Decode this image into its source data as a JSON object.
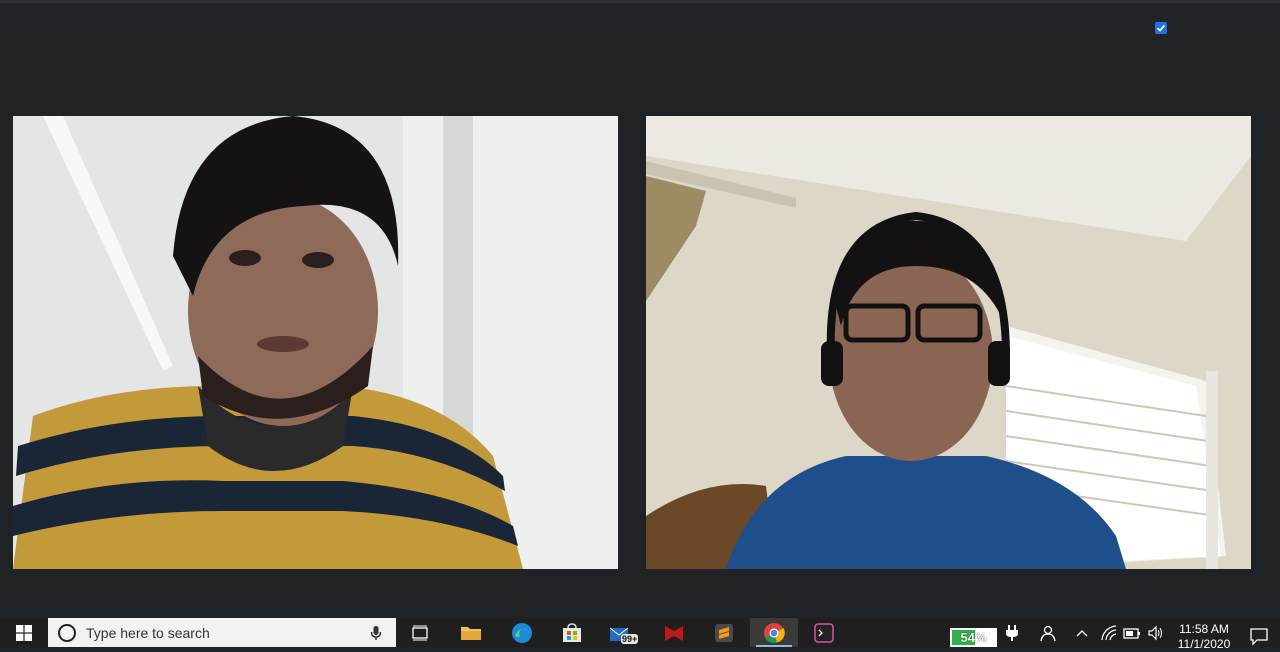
{
  "window": {
    "checkbox_checked": true
  },
  "video_tiles": [
    {
      "participant": "participant-1"
    },
    {
      "participant": "participant-2"
    }
  ],
  "taskbar": {
    "search_placeholder": "Type here to search",
    "apps": [
      "task-view",
      "file-explorer",
      "edge",
      "store",
      "mail",
      "mcafee",
      "sublime-text",
      "chrome",
      "terminal"
    ],
    "mail_badge": "99+",
    "battery_label": "54%",
    "battery_level": 0.54,
    "time": "11:58 AM",
    "date": "11/1/2020"
  },
  "colors": {
    "background": "#202326",
    "taskbar": "#1f1f1f",
    "accent": "#1a73e8",
    "battery": "#2bb34a"
  }
}
